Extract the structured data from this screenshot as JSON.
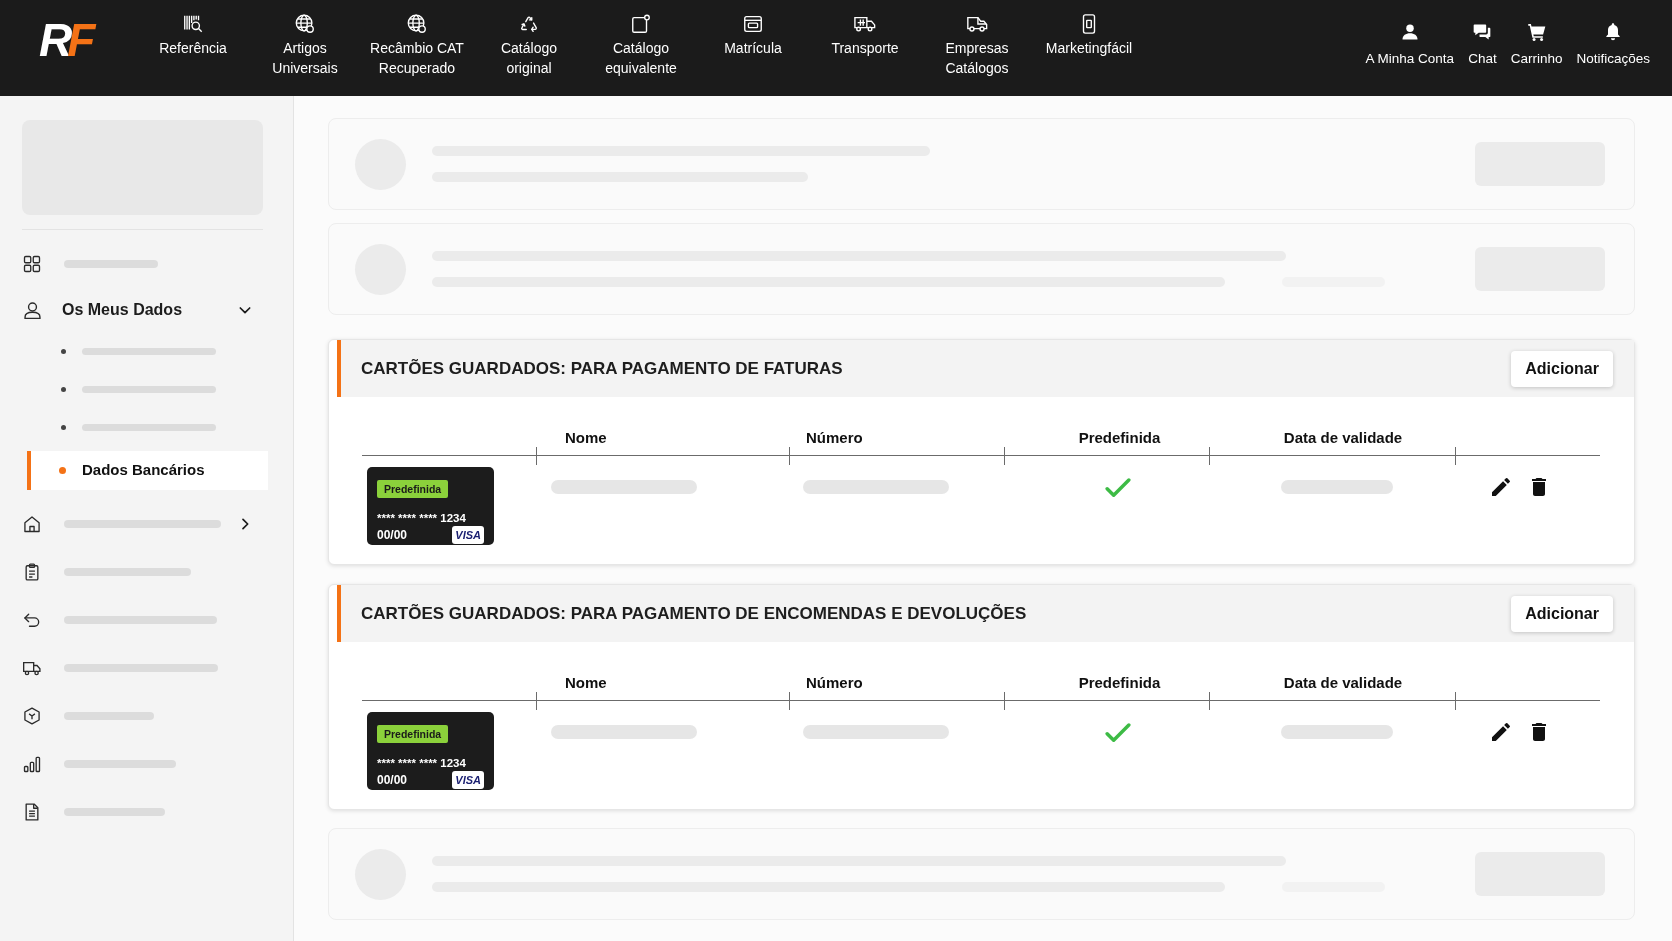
{
  "header": {
    "logo": [
      "R",
      "F"
    ],
    "nav": [
      {
        "label": "Referência"
      },
      {
        "label": "Artigos\nUniversais"
      },
      {
        "label": "Recâmbio CAT\nRecuperado"
      },
      {
        "label": "Catálogo\noriginal"
      },
      {
        "label": "Catálogo\nequivalente"
      },
      {
        "label": "Matrícula"
      },
      {
        "label": "Transporte"
      },
      {
        "label": "Empresas\nCatálogos"
      },
      {
        "label": "Marketingfácil"
      }
    ],
    "account": [
      {
        "label": "A Minha Conta"
      },
      {
        "label": "Chat"
      },
      {
        "label": "Carrinho"
      },
      {
        "label": "Notificações"
      }
    ]
  },
  "sidebar": {
    "items": [
      {
        "label": "Os Meus Dados",
        "expanded": true,
        "children": [
          {
            "label": "Dados Bancários",
            "selected": true
          }
        ]
      }
    ]
  },
  "sections": [
    {
      "title": "CARTÕES GUARDADOS: PARA PAGAMENTO DE FATURAS",
      "button": "Adicionar",
      "columns": [
        "Nome",
        "Número",
        "Predefinida",
        "Data de validade"
      ],
      "rows": [
        {
          "card": {
            "badge": "Predefinida",
            "number": "**** **** **** 1234",
            "expiry": "00/00",
            "brand": "VISA"
          },
          "default": true
        }
      ]
    },
    {
      "title": "CARTÕES GUARDADOS: PARA PAGAMENTO DE ENCOMENDAS E DEVOLUÇÕES",
      "button": "Adicionar",
      "columns": [
        "Nome",
        "Número",
        "Predefinida",
        "Data de validade"
      ],
      "rows": [
        {
          "card": {
            "badge": "Predefinida",
            "number": "**** **** **** 1234",
            "expiry": "00/00",
            "brand": "VISA"
          },
          "default": true
        }
      ]
    }
  ]
}
